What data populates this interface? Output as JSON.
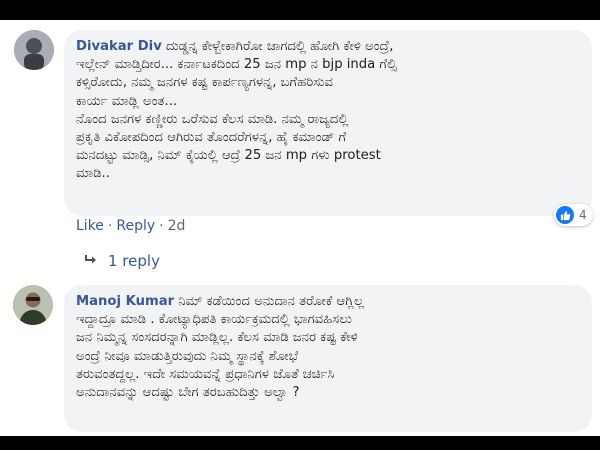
{
  "comments": [
    {
      "author": "Divakar Div",
      "lines": [
        "ದುಡ್ಡನ್ನ ಕೇಳ್ಬೇಕಾಗಿರೋ ಜಾಗದಲ್ಲಿ ಹೋಗಿ ಕೇಳಿ ಅಂದ್ರೆ,",
        "ಇಲ್ಲೇನ್ ಮಾಡ್ತಿದೀರ... ಕರ್ನಾಟಕದಿಂದ 25 ಜನ mp ನ bjp inda ಗೆಲ್ಸಿ",
        "ಕಳ್ಸಿರೋದು, ನಮ್ಮ ಜನಗಳ ಕಷ್ಟ ಕಾರ್ಪಣ್ಯಗಳನ್ನ, ಬಗೆಹರಿಸುವ",
        "ಕಾರ್ಯ ಮಾಡ್ಲಿ ಅಂತ...",
        "ನೊಂದ ಜನಗಳ ಕಣ್ಣೀರು ಒರೆಸುವ ಕೆಲಸ ಮಾಡಿ. ನಮ್ಮ ರಾಜ್ಯದಲ್ಲಿ",
        "ಪ್ರಕೃತಿ ವಿಕೋಪದಿಂದ ಆಗಿರುವ ತೊಂದರೆಗಳನ್ನ, ಹೈ ಕಮಾಂಡ್ ಗೆ",
        "ಮನದಟ್ಟು ಮಾಡ್ಸಿ, ನಿಮ್ ಕೈಯಲ್ಲಿ ಆದ್ರೆ 25 ಜನ mp ಗಳು protest",
        "ಮಾಡಿ.."
      ],
      "actions": {
        "like": "Like",
        "reply": "Reply",
        "time": "2d",
        "separator": "·"
      },
      "reaction_count": "4",
      "replies_label": "1 reply"
    },
    {
      "author": "Manoj Kumar",
      "lines": [
        "ನಿಮ್ ಕಡೆಯಿಂದ ಅನುದಾನ ತರೋಕೆ ಆಗ್ಲಿಲ್ಲ",
        "ಇದ್ದಾದ್ರೂ ಮಾಡಿ . ಕೋಟ್ಯಾಧಿಪತಿ ಕಾರ್ಯಕ್ರಮದಲ್ಲಿ ಭಾಗವಹಿಸಲು",
        "ಜನ ನಿಮ್ಮನ್ನ ಸಂಸದರನ್ನಾಗಿ ಮಾಡ್ಲಿಲ್ಲ. ಕೆಲಸ ಮಾಡಿ ಜನರ ಕಷ್ಟ ಕೇಳಿ",
        "ಅಂದ್ರೆ ನೀವೂ ಮಾಡುತ್ತಿರುವುದು ನಿಮ್ಮ ಸ್ಥಾನಕ್ಕೆ ಶೋಭೆ",
        "ತರುವಂತದ್ದಲ್ಲ. ಇದೇ ಸಮಯವನ್ನೆ ಪ್ರಧಾನಿಗಳ ಜೊತೆ ಚರ್ಚಿಸಿ",
        "ಅನುದಾನವನ್ನು ಆದಷ್ಟು ಬೇಗ ತರಬಹುದಿತ್ತು ಅಲ್ವಾ ?"
      ]
    }
  ],
  "colors": {
    "author": "#385898",
    "bubble": "#f2f3f5",
    "like_badge": "#1877f2"
  },
  "icons": {
    "reaction": "thumbs-up-icon",
    "reply_arrow": "reply-arrow-icon"
  }
}
